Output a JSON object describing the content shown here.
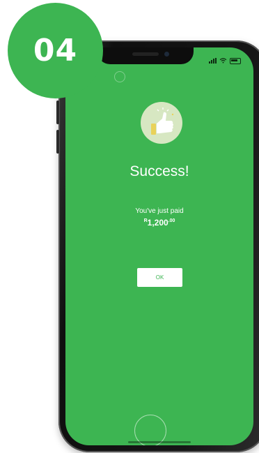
{
  "badge": {
    "step": "04"
  },
  "colors": {
    "brand_green": "#3db552",
    "icon_circle": "#d7e7c2",
    "thumb": "#ffffff",
    "cuff": "#e9d25a"
  },
  "status_bar": {
    "left_icon": "location-arrow-icon",
    "right_icons": [
      "cellular-signal-icon",
      "wifi-icon",
      "battery-icon"
    ]
  },
  "success_screen": {
    "icon": "thumbs-up-icon",
    "title": "Success!",
    "message": "You've just paid",
    "amount": {
      "currency": "R",
      "whole": "1,200",
      "cents": ".00"
    },
    "ok_label": "OK"
  }
}
